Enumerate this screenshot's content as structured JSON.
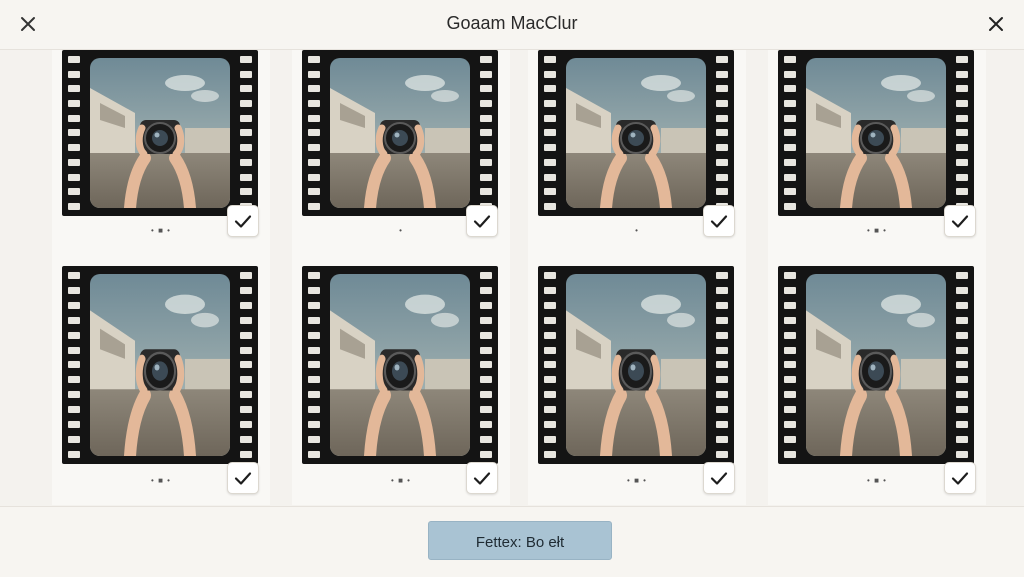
{
  "header": {
    "title": "Goaam MacClur",
    "left_icon": "close-icon",
    "right_icon": "close-icon"
  },
  "photos": [
    {
      "id": 1,
      "selected": true,
      "caption": "• ■ •"
    },
    {
      "id": 2,
      "selected": true,
      "caption": "•"
    },
    {
      "id": 3,
      "selected": true,
      "caption": "•"
    },
    {
      "id": 4,
      "selected": true,
      "caption": "• ■ •"
    },
    {
      "id": 5,
      "selected": true,
      "caption": "• ■ •"
    },
    {
      "id": 6,
      "selected": true,
      "caption": "• ■ •"
    },
    {
      "id": 7,
      "selected": true,
      "caption": "• ■ •"
    },
    {
      "id": 8,
      "selected": true,
      "caption": "• ■ •"
    }
  ],
  "footer": {
    "button_label": "Fettex: Bo ełt"
  },
  "colors": {
    "accent_button": "#a9c3d3",
    "film": "#141414",
    "background": "#f4f2ee"
  }
}
